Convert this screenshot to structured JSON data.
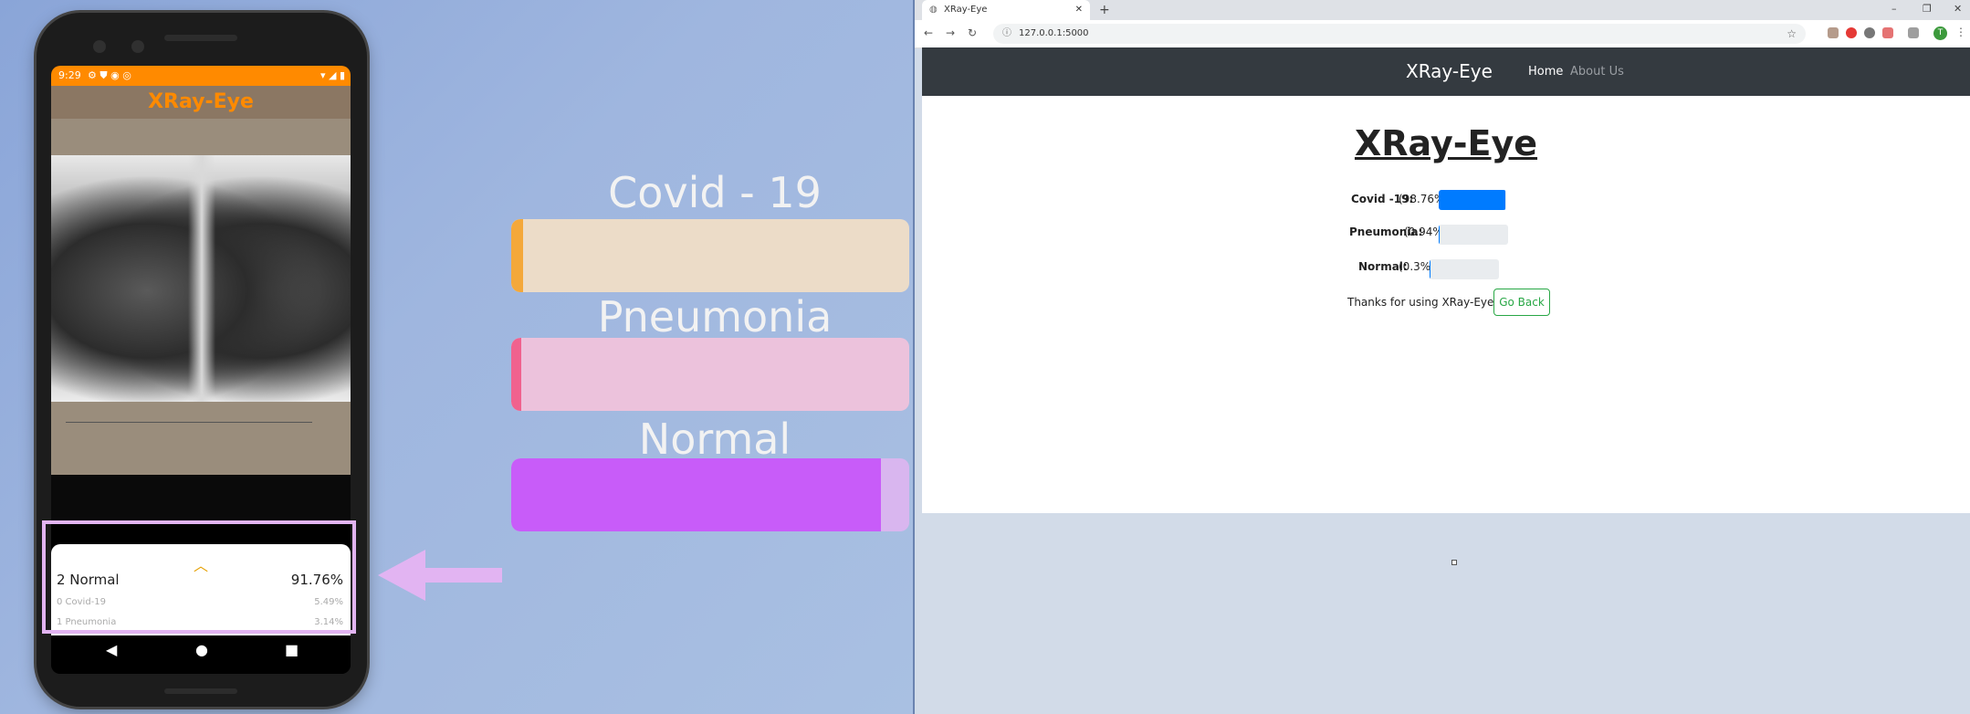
{
  "phone": {
    "status_time": "9:29",
    "app_title": "XRay-Eye",
    "results": {
      "top_label": "2 Normal",
      "top_value": "91.76%",
      "rows": [
        {
          "label": "0 Covid-19",
          "value": "5.49%"
        },
        {
          "label": "1 Pneumonia",
          "value": "3.14%"
        }
      ]
    },
    "nav": {
      "back": "◀",
      "home": "●",
      "recents": "■"
    }
  },
  "bars": [
    {
      "label": "Covid - 19",
      "fraction": 0.03,
      "fill_color": "#f4a83a",
      "track_color": "#ecdcc8"
    },
    {
      "label": "Pneumonia",
      "fraction": 0.025,
      "fill_color": "#f0628e",
      "track_color": "#ecc2dc"
    },
    {
      "label": "Normal",
      "fraction": 0.93,
      "fill_color": "#c85cf9",
      "track_color": "#d9b6ef"
    }
  ],
  "browser": {
    "tab_title": "XRay-Eye",
    "tab_close": "✕",
    "new_tab": "+",
    "url": "127.0.0.1:5000",
    "window_controls": [
      "–",
      "❐",
      "✕"
    ],
    "avatar_letter": "T"
  },
  "site": {
    "brand": "XRay-Eye",
    "nav": [
      "Home",
      "About Us"
    ],
    "heading": "XRay-Eye",
    "predictions": [
      {
        "label": "Covid -19:",
        "percent": "(98.76%)",
        "fraction": 0.9876
      },
      {
        "label": "Pneumonia:",
        "percent": "(0.94%)",
        "fraction": 0.0094
      },
      {
        "label": "Normal:",
        "percent": "(0.3%)",
        "fraction": 0.003
      }
    ],
    "thanks": "Thanks for using XRay-Eye",
    "go_back": "Go Back"
  },
  "colors": {
    "app_orange": "#ff8a00",
    "navbar_dark": "#343a40",
    "progress_blue": "#007bff",
    "button_green": "#28a745",
    "highlight_purple": "#e2b4f2"
  }
}
